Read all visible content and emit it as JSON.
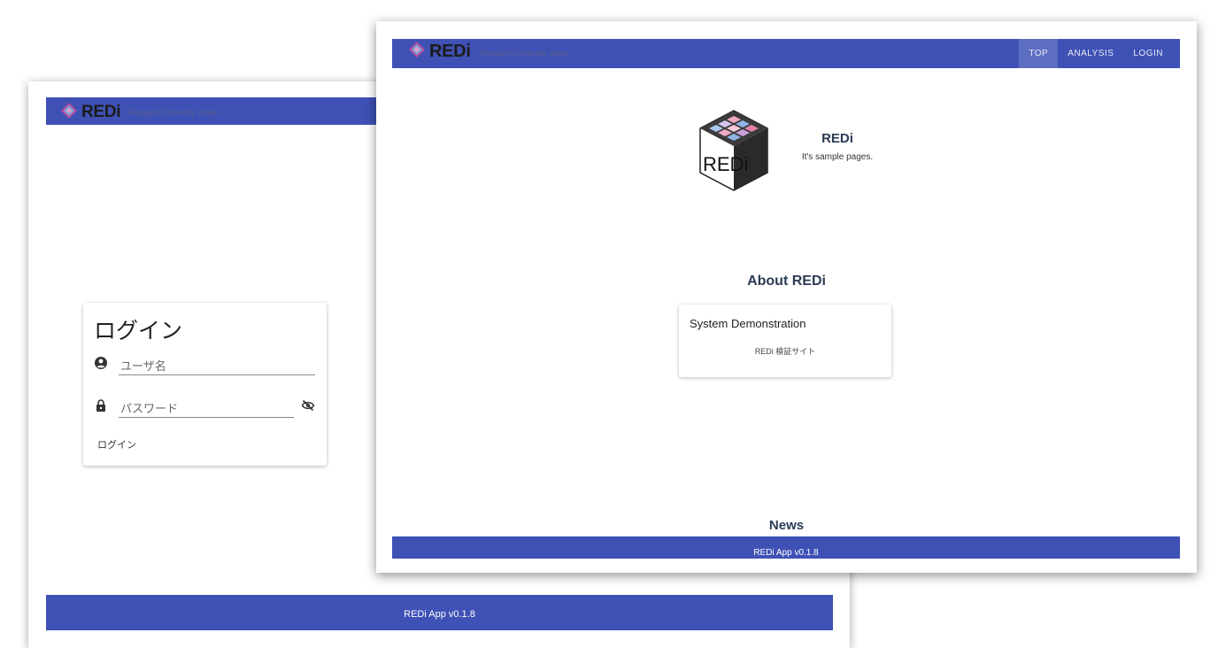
{
  "brand": {
    "name": "REDi",
    "tagline": "- Research Diversity Index -"
  },
  "login_window": {
    "title": "ログイン",
    "username_placeholder": "ユーザ名",
    "password_placeholder": "パスワード",
    "login_button": "ログイン",
    "footer": "REDi App v0.1.8"
  },
  "top_window": {
    "nav": [
      {
        "label": "TOP",
        "active": true
      },
      {
        "label": "ANALYSIS",
        "active": false
      },
      {
        "label": "LOGIN",
        "active": false
      }
    ],
    "hero": {
      "logo_text": "REDi",
      "title": "REDi",
      "subtitle": "It's sample pages."
    },
    "about": {
      "heading": "About REDi",
      "card_title": "System Demonstration",
      "card_text": "REDi 検証サイト"
    },
    "news_heading": "News",
    "footer": "REDi App v0.1.8"
  },
  "colors": {
    "primary": "#3f51b5",
    "heading": "#2b3a55"
  },
  "icons": {
    "user": "account-circle-icon",
    "password": "lock-icon",
    "visibility": "eye-off-icon"
  }
}
